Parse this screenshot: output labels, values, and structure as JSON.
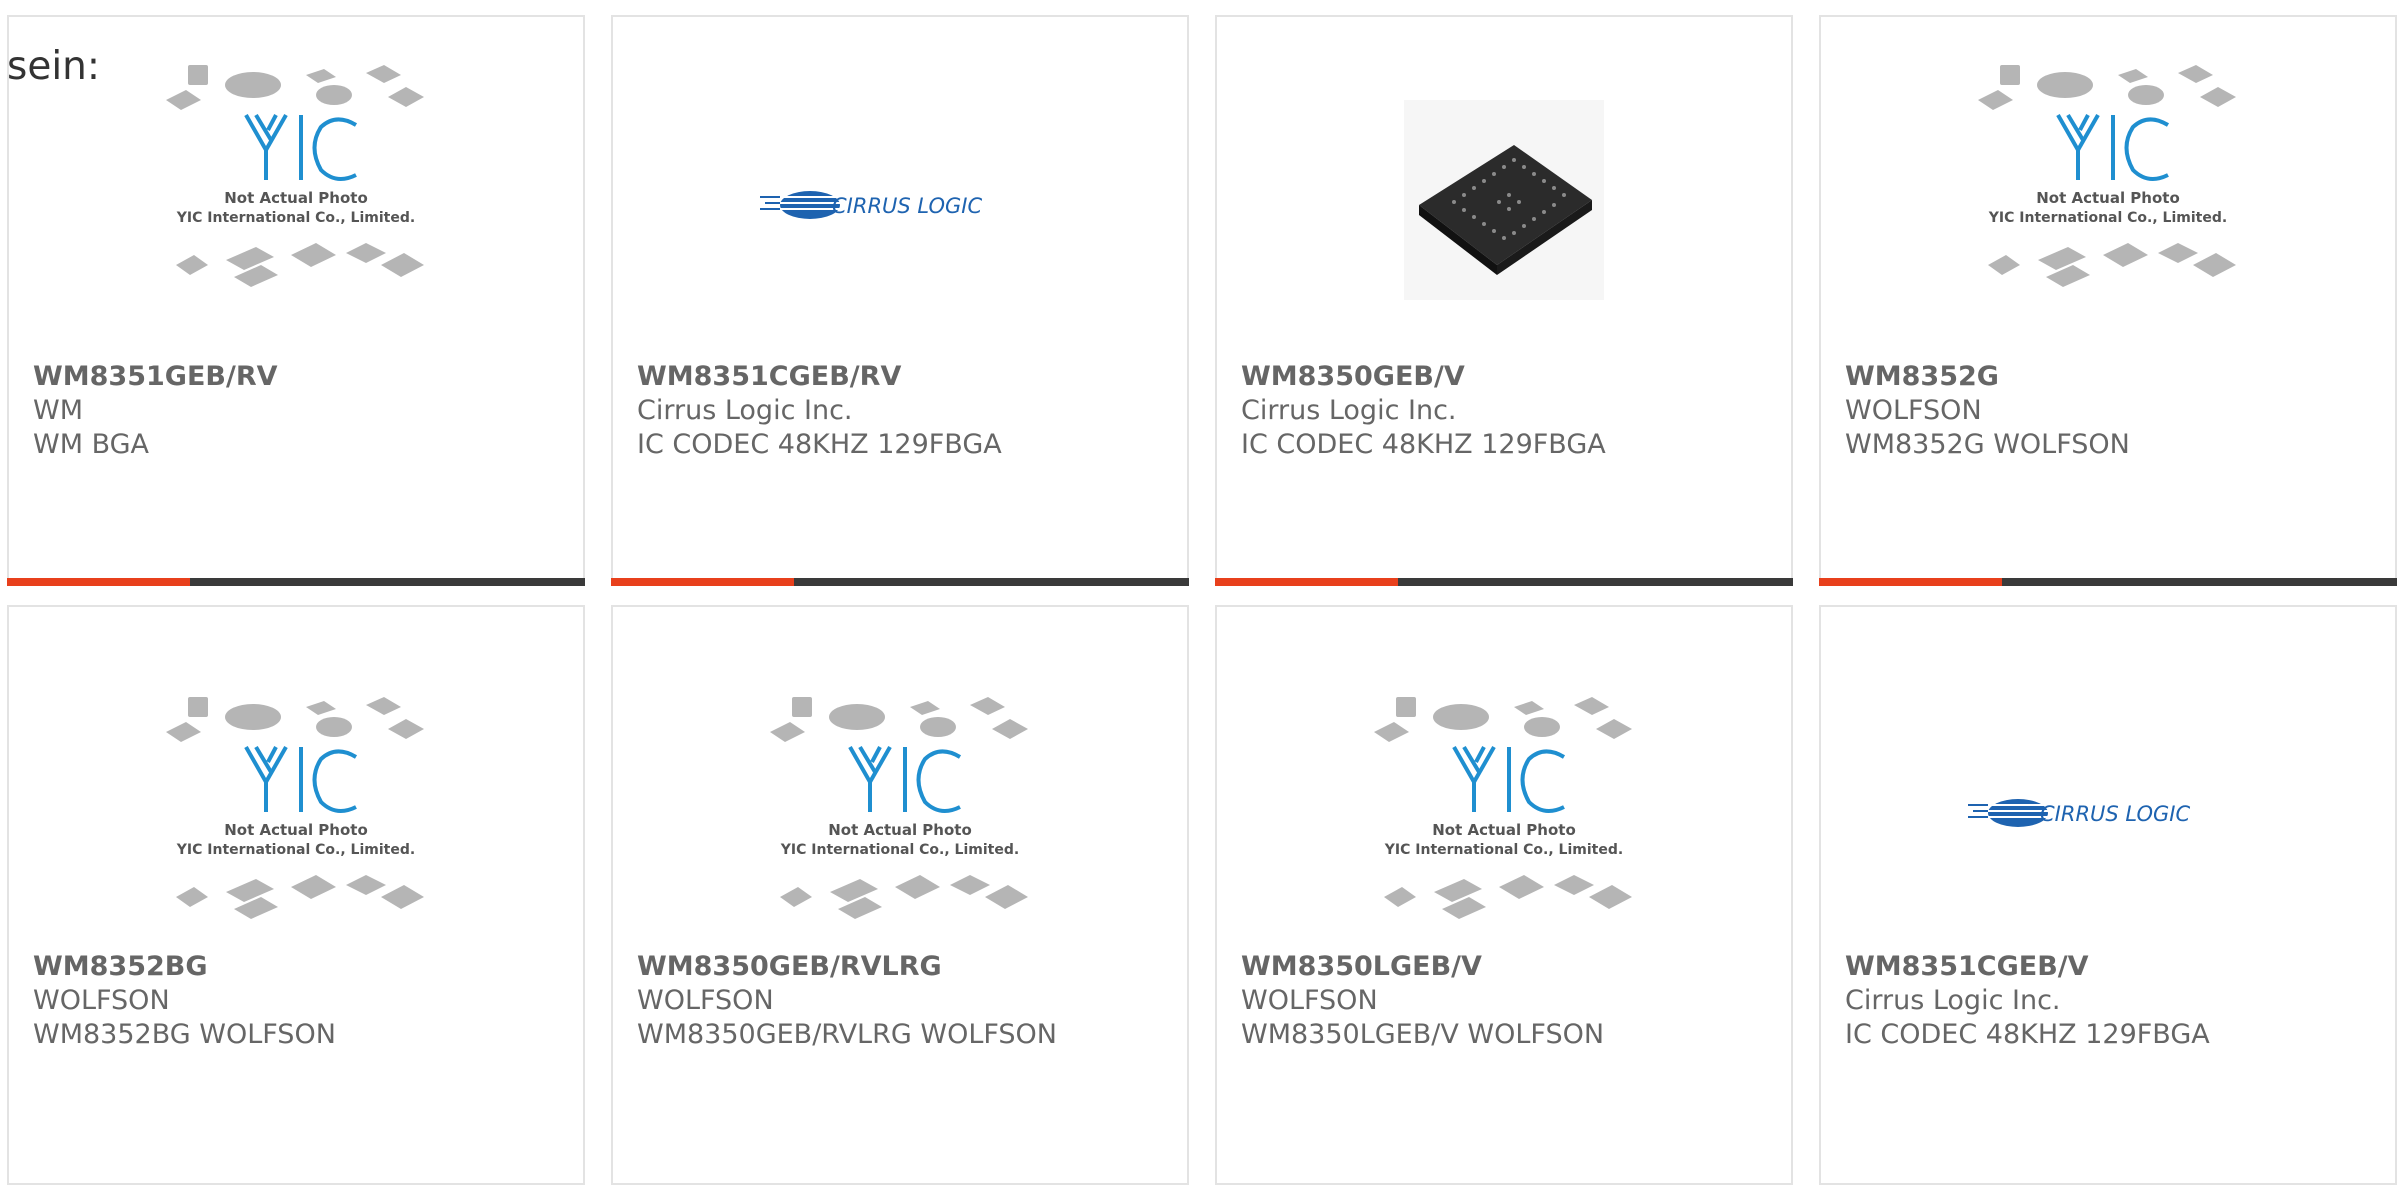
{
  "intro_text": "sein:",
  "colors": {
    "accent_bar": "#e8401c",
    "bar_base": "#3a3a3a",
    "border": "#e3e3e3",
    "text": "#666666",
    "yic_blue": "#1f8fd0",
    "cirrus_blue": "#1e63b0"
  },
  "products": [
    {
      "part_number": "WM8351GEB/RV",
      "manufacturer": "WM",
      "description": "WM BGA",
      "image": "yic-placeholder-icon",
      "placeholder_line1": "Not Actual Photo",
      "placeholder_line2": "YIC International Co., Limited."
    },
    {
      "part_number": "WM8351CGEB/RV",
      "manufacturer": "Cirrus Logic Inc.",
      "description": "IC CODEC 48KHZ 129FBGA",
      "image": "cirrus-logic-logo",
      "logo_text": "CIRRUS LOGIC"
    },
    {
      "part_number": "WM8350GEB/V",
      "manufacturer": "Cirrus Logic Inc.",
      "description": "IC CODEC 48KHZ 129FBGA",
      "image": "bga-chip-photo"
    },
    {
      "part_number": "WM8352G",
      "manufacturer": "WOLFSON",
      "description": "WM8352G WOLFSON",
      "image": "yic-placeholder-icon",
      "placeholder_line1": "Not Actual Photo",
      "placeholder_line2": "YIC International Co., Limited."
    },
    {
      "part_number": "WM8352BG",
      "manufacturer": "WOLFSON",
      "description": "WM8352BG WOLFSON",
      "image": "yic-placeholder-icon",
      "placeholder_line1": "Not Actual Photo",
      "placeholder_line2": "YIC International Co., Limited."
    },
    {
      "part_number": "WM8350GEB/RVLRG",
      "manufacturer": "WOLFSON",
      "description": "WM8350GEB/RVLRG WOLFSON",
      "image": "yic-placeholder-icon",
      "placeholder_line1": "Not Actual Photo",
      "placeholder_line2": "YIC International Co., Limited."
    },
    {
      "part_number": "WM8350LGEB/V",
      "manufacturer": "WOLFSON",
      "description": "WM8350LGEB/V WOLFSON",
      "image": "yic-placeholder-icon",
      "placeholder_line1": "Not Actual Photo",
      "placeholder_line2": "YIC International Co., Limited."
    },
    {
      "part_number": "WM8351CGEB/V",
      "manufacturer": "Cirrus Logic Inc.",
      "description": "IC CODEC 48KHZ 129FBGA",
      "image": "cirrus-logic-logo",
      "logo_text": "CIRRUS LOGIC"
    }
  ]
}
